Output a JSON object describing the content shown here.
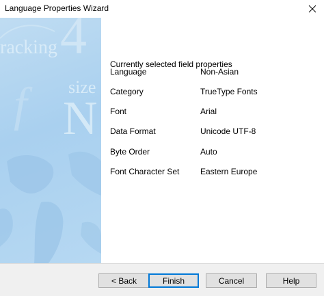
{
  "window": {
    "title": "Language Properties Wizard",
    "close_icon": "close-icon"
  },
  "side_panel": {
    "watermark_words": [
      "racking",
      "size"
    ],
    "watermark_glyphs": [
      "4",
      "N"
    ]
  },
  "main": {
    "heading": "Currently selected field properties",
    "properties": [
      {
        "label": "Language",
        "value": "Non-Asian"
      },
      {
        "label": "Category",
        "value": "TrueType Fonts"
      },
      {
        "label": "Font",
        "value": "Arial"
      },
      {
        "label": "Data Format",
        "value": "Unicode UTF-8"
      },
      {
        "label": "Byte Order",
        "value": "Auto"
      },
      {
        "label": "Font Character Set",
        "value": "Eastern Europe"
      }
    ]
  },
  "buttons": {
    "back": "< Back",
    "finish": "Finish",
    "cancel": "Cancel",
    "help": "Help"
  },
  "colors": {
    "panel_blue": "#a9d0ef",
    "default_button_border": "#0078d7"
  }
}
